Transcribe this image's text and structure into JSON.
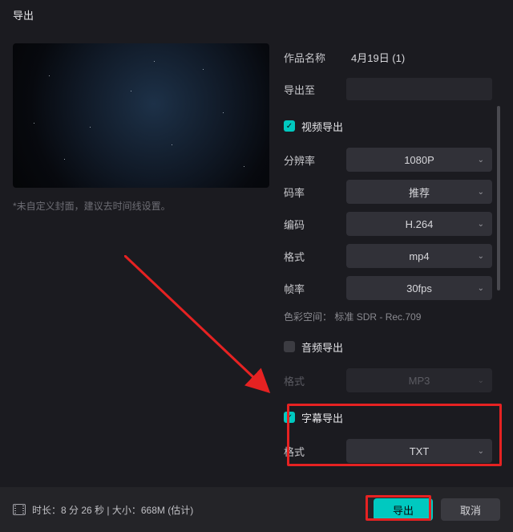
{
  "dialog": {
    "title": "导出"
  },
  "preview": {
    "hint": "*未自定义封面，建议去时间线设置。"
  },
  "fields": {
    "project_name": {
      "label": "作品名称",
      "value": "4月19日 (1)"
    },
    "export_to": {
      "label": "导出至",
      "value": ""
    }
  },
  "video": {
    "title": "视频导出",
    "checked": true,
    "resolution": {
      "label": "分辨率",
      "value": "1080P"
    },
    "bitrate": {
      "label": "码率",
      "value": "推荐"
    },
    "codec": {
      "label": "编码",
      "value": "H.264"
    },
    "format": {
      "label": "格式",
      "value": "mp4"
    },
    "fps": {
      "label": "帧率",
      "value": "30fps"
    },
    "colorspace": {
      "label": "色彩空间：",
      "value": "标准 SDR - Rec.709"
    }
  },
  "audio": {
    "title": "音频导出",
    "checked": false,
    "format": {
      "label": "格式",
      "value": "MP3"
    }
  },
  "subtitle": {
    "title": "字幕导出",
    "checked": true,
    "format": {
      "label": "格式",
      "value": "TXT"
    }
  },
  "footer": {
    "duration_label": "时长：",
    "duration_value": "8 分 26 秒",
    "sep": " | ",
    "size_label": "大小：",
    "size_value": "668M",
    "size_suffix": "  (估计)",
    "export": "导出",
    "cancel": "取消"
  }
}
